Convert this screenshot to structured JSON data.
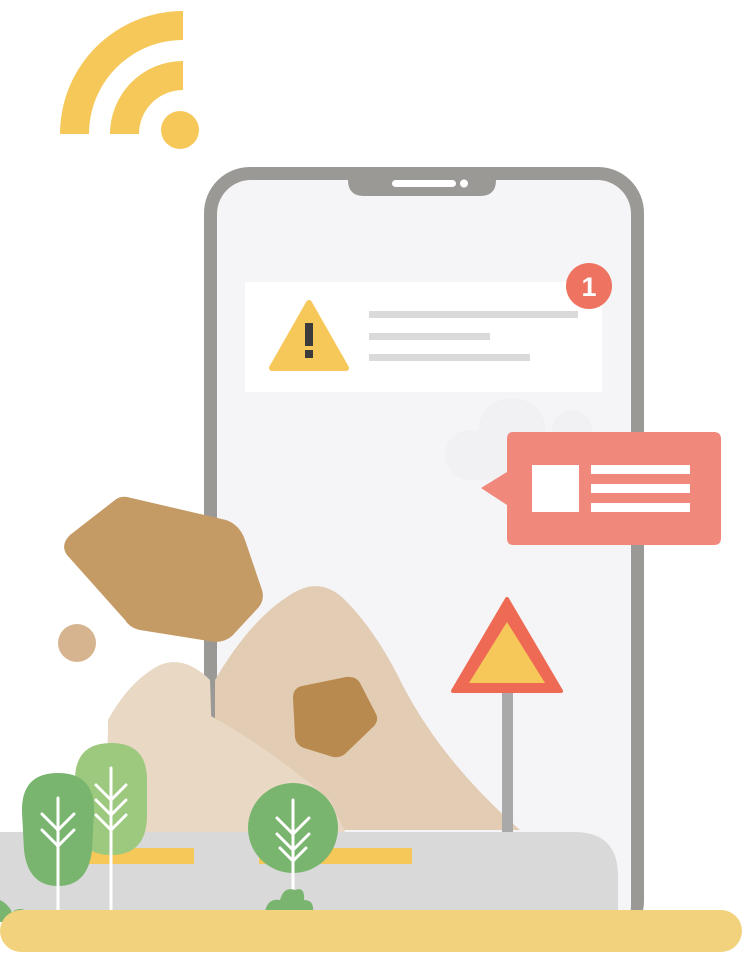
{
  "notification": {
    "badge_count": "1",
    "icon": "warning-icon",
    "badge_color": "#ee7361"
  },
  "popup": {
    "icon": "message-card-icon",
    "color": "#f0887c"
  },
  "signal": {
    "icon": "wifi-icon",
    "color": "#f6c85a"
  },
  "road_sign": {
    "icon": "warning-sign-icon",
    "border_color": "#ee6a55",
    "fill_color": "#f6c85a"
  },
  "phone": {
    "frame_color": "#9a9996",
    "screen_color": "#f5f4f6"
  },
  "ground_color": "#f2d27d"
}
